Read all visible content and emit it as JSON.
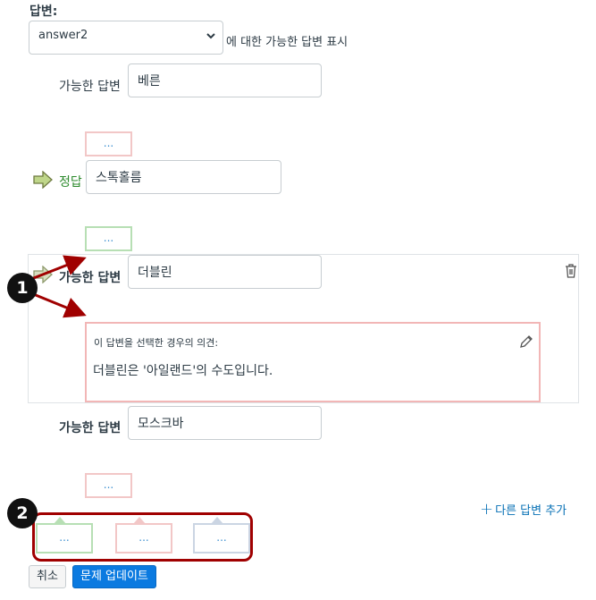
{
  "header": {
    "label": "답변:"
  },
  "answer_selector": {
    "value": "answer2",
    "suffix": "에 대한 가능한 답변 표시"
  },
  "answers": [
    {
      "label": "가능한 답변",
      "value": "베른"
    },
    {
      "label": "정답",
      "value": "스톡홀름"
    },
    {
      "label": "가능한 답변",
      "value": "더블린",
      "comment_title": "이 답변을 선택한 경우의 의견:",
      "comment_text": "더블린은 '아일랜드'의 수도입니다."
    },
    {
      "label": "가능한 답변",
      "value": "모스크바"
    }
  ],
  "comment_placeholder": "...",
  "add_answer": {
    "icon": "plus-icon",
    "label": "다른 답변 추가"
  },
  "general_comments": [
    "...",
    "...",
    "..."
  ],
  "buttons": {
    "cancel": "취소",
    "update": "문제 업데이트"
  },
  "callouts": [
    "1",
    "2"
  ],
  "colors": {
    "accent": "#0770b5",
    "correct": "#2e8b2e",
    "callout": "#a00000",
    "button_primary": "#0b7ae0"
  }
}
